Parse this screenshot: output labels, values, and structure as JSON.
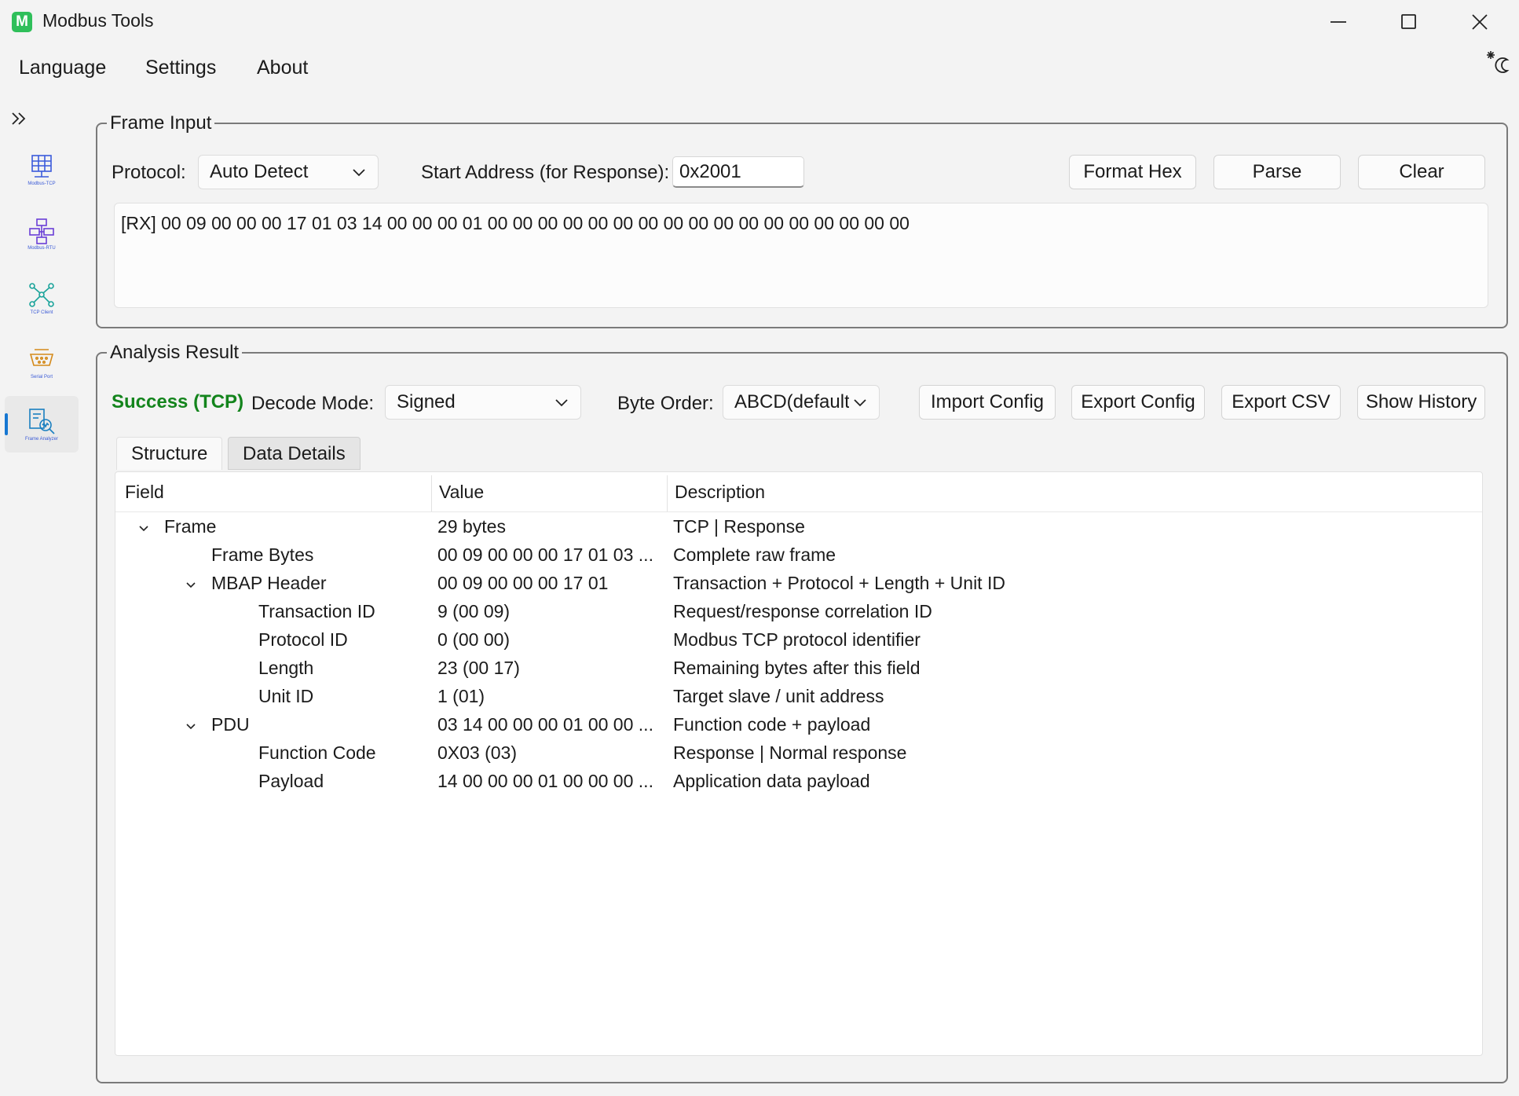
{
  "window": {
    "title": "Modbus Tools",
    "logo_letter": "M"
  },
  "menu": [
    "Language",
    "Settings",
    "About"
  ],
  "nav": [
    {
      "label": "Modbus-TCP",
      "icon": "grid-network-icon"
    },
    {
      "label": "Modbus-RTU",
      "icon": "rtu-network-icon"
    },
    {
      "label": "TCP Client",
      "icon": "client-network-icon"
    },
    {
      "label": "Serial Port",
      "icon": "serial-port-icon"
    },
    {
      "label": "Frame Analyzer",
      "icon": "frame-analyzer-icon"
    }
  ],
  "frame_input": {
    "title": "Frame Input",
    "protocol_label": "Protocol:",
    "protocol_value": "Auto Detect",
    "start_address_label": "Start Address (for Response):",
    "start_address_value": "0x2001",
    "buttons": {
      "format_hex": "Format Hex",
      "parse": "Parse",
      "clear": "Clear"
    },
    "frame_text": "[RX] 00 09 00 00 00 17 01 03 14 00 00 00 01 00 00 00 00 00 00 00 00 00 00 00 00 00 00 00 00 00"
  },
  "analysis": {
    "title": "Analysis Result",
    "status": "Success (TCP)",
    "status_color": "#13841c",
    "decode_mode_label": "Decode Mode:",
    "decode_mode_value": "Signed",
    "byte_order_label": "Byte Order:",
    "byte_order_value": "ABCD(default)",
    "buttons": {
      "import_config": "Import Config",
      "export_config": "Export Config",
      "export_csv": "Export CSV",
      "show_history": "Show History"
    },
    "tabs": [
      "Structure",
      "Data Details"
    ],
    "columns": [
      "Field",
      "Value",
      "Description"
    ],
    "rows": [
      {
        "field": "Frame",
        "value": "29 bytes",
        "desc": "TCP | Response",
        "level": 0,
        "expandable": true
      },
      {
        "field": "Frame Bytes",
        "value": "00 09 00 00 00 17 01 03 ...",
        "desc": "Complete raw frame",
        "level": 1,
        "expandable": false
      },
      {
        "field": "MBAP Header",
        "value": "00 09 00 00 00 17 01",
        "desc": "Transaction + Protocol + Length + Unit ID",
        "level": 1,
        "expandable": true
      },
      {
        "field": "Transaction ID",
        "value": "9 (00 09)",
        "desc": "Request/response correlation ID",
        "level": 2,
        "expandable": false
      },
      {
        "field": "Protocol ID",
        "value": "0 (00 00)",
        "desc": "Modbus TCP protocol identifier",
        "level": 2,
        "expandable": false
      },
      {
        "field": "Length",
        "value": "23 (00 17)",
        "desc": "Remaining bytes after this field",
        "level": 2,
        "expandable": false
      },
      {
        "field": "Unit ID",
        "value": "1 (01)",
        "desc": "Target slave / unit address",
        "level": 2,
        "expandable": false
      },
      {
        "field": "PDU",
        "value": "03 14 00 00 00 01 00 00 ...",
        "desc": "Function code + payload",
        "level": 1,
        "expandable": true
      },
      {
        "field": "Function Code",
        "value": "0X03 (03)",
        "desc": "Response | Normal response",
        "level": 2,
        "expandable": false
      },
      {
        "field": "Payload",
        "value": "14 00 00 00 01 00 00 00 ...",
        "desc": "Application data payload",
        "level": 2,
        "expandable": false
      }
    ]
  }
}
